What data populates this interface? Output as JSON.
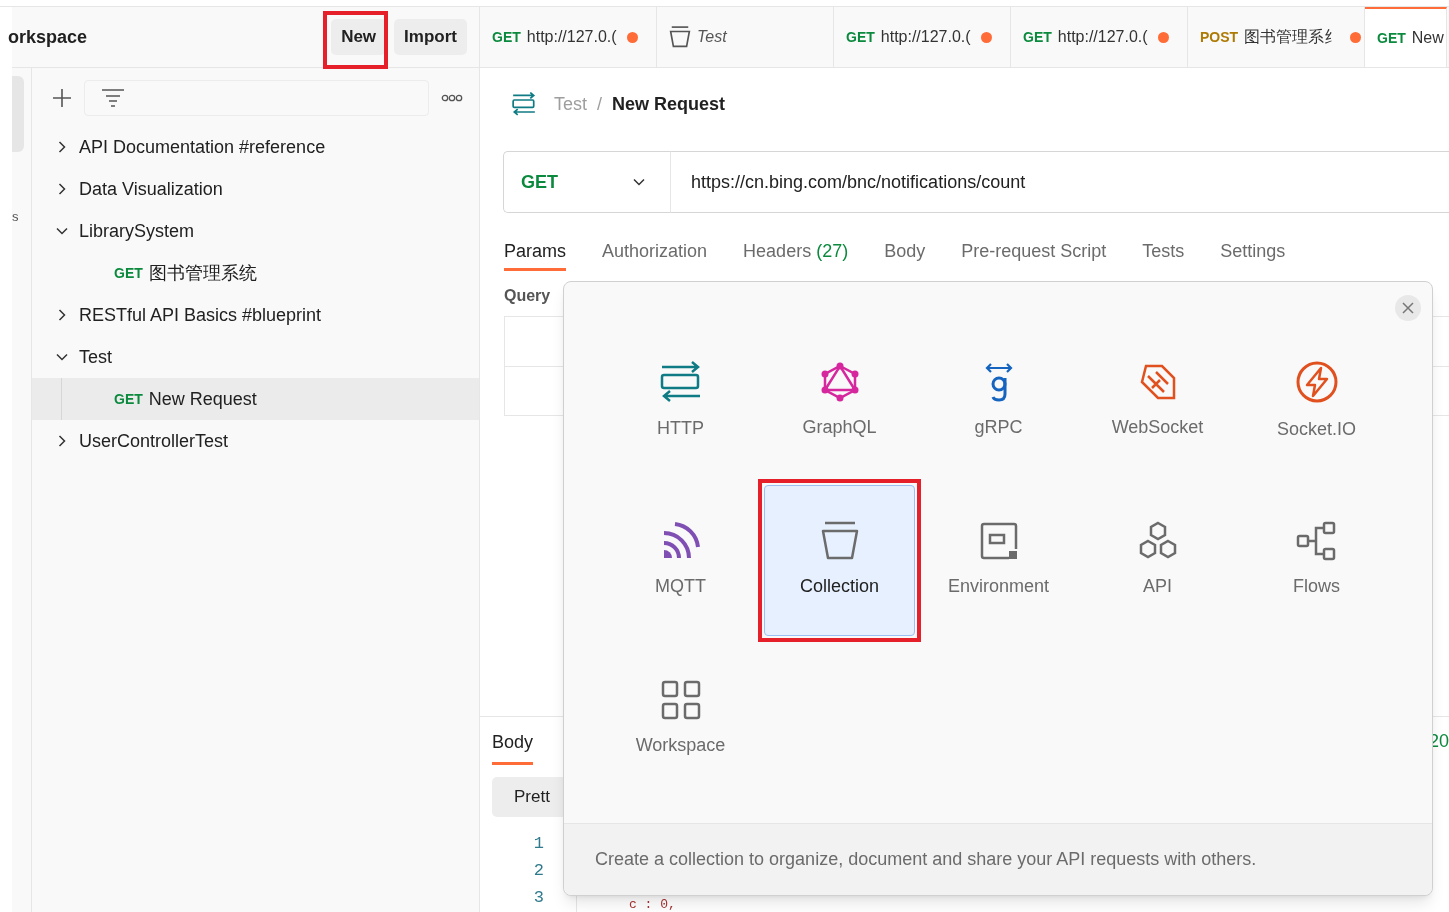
{
  "workspace": {
    "title": "orkspace",
    "buttons": [
      {
        "label": "New",
        "highlighted": true
      },
      {
        "label": "Import",
        "highlighted": false
      }
    ]
  },
  "rail": {
    "label": "s"
  },
  "sidebar": {
    "items": [
      {
        "kind": "folder",
        "label": "API Documentation #reference",
        "expanded": false
      },
      {
        "kind": "folder",
        "label": "Data Visualization",
        "expanded": false
      },
      {
        "kind": "folder",
        "label": "LibrarySystem",
        "expanded": true,
        "children": [
          {
            "kind": "request",
            "method": "GET",
            "label": "图书管理系统",
            "selected": false
          }
        ]
      },
      {
        "kind": "folder",
        "label": "RESTful API Basics #blueprint",
        "expanded": false
      },
      {
        "kind": "folder",
        "label": "Test",
        "expanded": true,
        "children": [
          {
            "kind": "request",
            "method": "GET",
            "label": "New Request",
            "selected": true
          }
        ]
      },
      {
        "kind": "folder",
        "label": "UserControllerTest",
        "expanded": false
      }
    ]
  },
  "tabs": [
    {
      "kind": "request",
      "method": "GET",
      "label": "http://127.0.(",
      "unsaved": true,
      "selected": false
    },
    {
      "kind": "collection",
      "label": "Test",
      "unsaved": false,
      "selected": false
    },
    {
      "kind": "request",
      "method": "GET",
      "label": "http://127.0.(",
      "unsaved": true,
      "selected": false
    },
    {
      "kind": "request",
      "method": "GET",
      "label": "http://127.0.(",
      "unsaved": true,
      "selected": false
    },
    {
      "kind": "request",
      "method": "POST",
      "label": "图书管理系纟",
      "unsaved": true,
      "selected": false
    },
    {
      "kind": "request",
      "method": "GET",
      "label": "New",
      "unsaved": false,
      "selected": true
    }
  ],
  "breadcrumb": {
    "parent": "Test",
    "separator": "/",
    "current": "New Request"
  },
  "request": {
    "method": "GET",
    "url": "https://cn.bing.com/bnc/notifications/count"
  },
  "request_tabs": [
    {
      "label": "Params",
      "selected": true
    },
    {
      "label": "Authorization",
      "selected": false
    },
    {
      "label": "Headers",
      "count": "(27)",
      "selected": false
    },
    {
      "label": "Body",
      "selected": false
    },
    {
      "label": "Pre-request Script",
      "selected": false
    },
    {
      "label": "Tests",
      "selected": false
    },
    {
      "label": "Settings",
      "selected": false
    }
  ],
  "query_label": "Query",
  "response": {
    "tabs": [
      {
        "label": "Body",
        "selected": true
      }
    ],
    "status": "20",
    "view": "Prett",
    "line_numbers": [
      "1",
      "2",
      "3"
    ],
    "code_fragment": "c : 0,"
  },
  "modal": {
    "items": [
      {
        "label": "HTTP",
        "selected": false,
        "highlighted": false
      },
      {
        "label": "GraphQL",
        "selected": false,
        "highlighted": false
      },
      {
        "label": "gRPC",
        "selected": false,
        "highlighted": false
      },
      {
        "label": "WebSocket",
        "selected": false,
        "highlighted": false
      },
      {
        "label": "Socket.IO",
        "selected": false,
        "highlighted": false
      },
      {
        "label": "MQTT",
        "selected": false,
        "highlighted": false
      },
      {
        "label": "Collection",
        "selected": true,
        "highlighted": true
      },
      {
        "label": "Environment",
        "selected": false,
        "highlighted": false
      },
      {
        "label": "API",
        "selected": false,
        "highlighted": false
      },
      {
        "label": "Flows",
        "selected": false,
        "highlighted": false
      },
      {
        "label": "Workspace",
        "selected": false,
        "highlighted": false
      }
    ],
    "description": "Create a collection to organize, document and share your API requests with others."
  }
}
